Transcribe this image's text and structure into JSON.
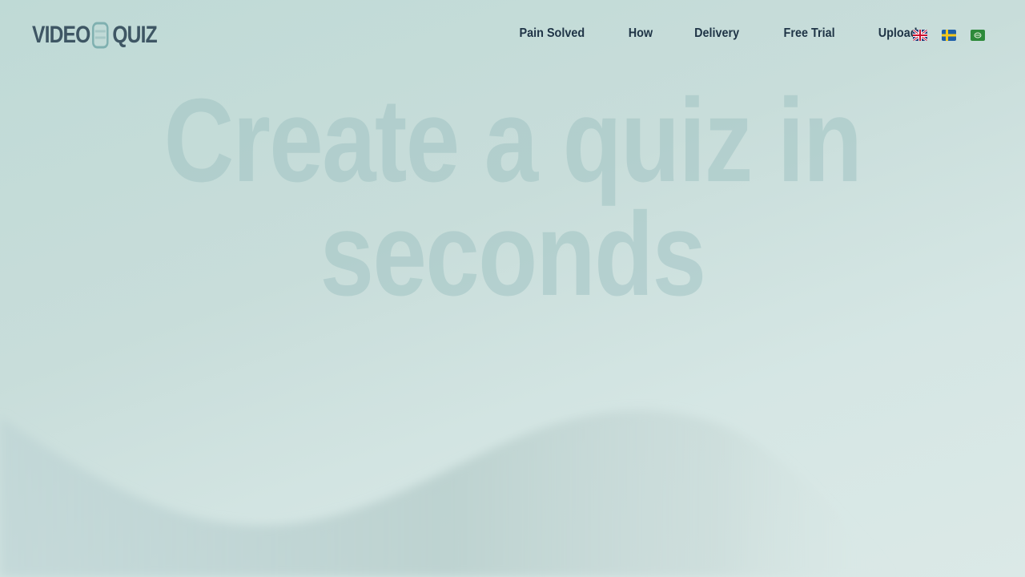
{
  "logo": {
    "left": "VIDEO",
    "right": "QUIZ"
  },
  "nav": {
    "items": [
      "Pain Solved",
      "How",
      "Delivery",
      "Free Trial",
      "Upload"
    ]
  },
  "languages": [
    {
      "name": "English",
      "icon": "uk-flag-icon"
    },
    {
      "name": "Swedish",
      "icon": "sweden-flag-icon"
    },
    {
      "name": "Arabic",
      "icon": "saudi-flag-icon"
    }
  ],
  "hero": {
    "line1": "Create a quiz in",
    "line2": "seconds"
  },
  "colors": {
    "nav_text": "#1f3446",
    "logo": "#3e5664",
    "hero_text": "#a0c3c3",
    "background": "#c8ddda"
  }
}
